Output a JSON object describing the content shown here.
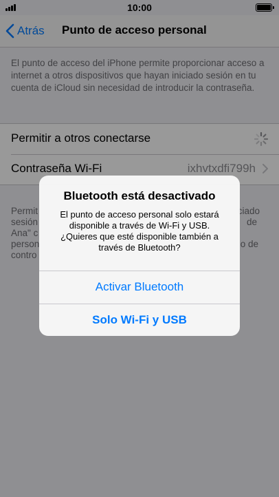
{
  "status_bar": {
    "time": "10:00"
  },
  "nav": {
    "back_label": "Atrás",
    "title": "Punto de acceso personal"
  },
  "info_text": "El punto de acceso del iPhone permite proporcionar acceso a internet a otros dispositivos que hayan iniciado sesión en tu cuenta de iCloud sin necesidad de introducir la contraseña.",
  "settings": {
    "allow_others_label": "Permitir a otros conectarse",
    "wifi_password_label": "Contraseña Wi-Fi",
    "wifi_password_value": "ixhvtxdfi799h"
  },
  "footer_fragments": {
    "left": [
      "Permit",
      "sesión",
      "Ana\" c",
      "person",
      "contro"
    ],
    "right": [
      "ciado",
      "de",
      "",
      "o de",
      ""
    ]
  },
  "alert": {
    "title": "Bluetooth está desactivado",
    "message": "El punto de acceso personal solo estará disponible a través de Wi-Fi y USB. ¿Quieres que esté disponible también a través de Bluetooth?",
    "primary_button": "Activar Bluetooth",
    "secondary_button": "Solo Wi-Fi y USB"
  },
  "colors": {
    "accent": "#007aff",
    "background": "#efeff4"
  }
}
